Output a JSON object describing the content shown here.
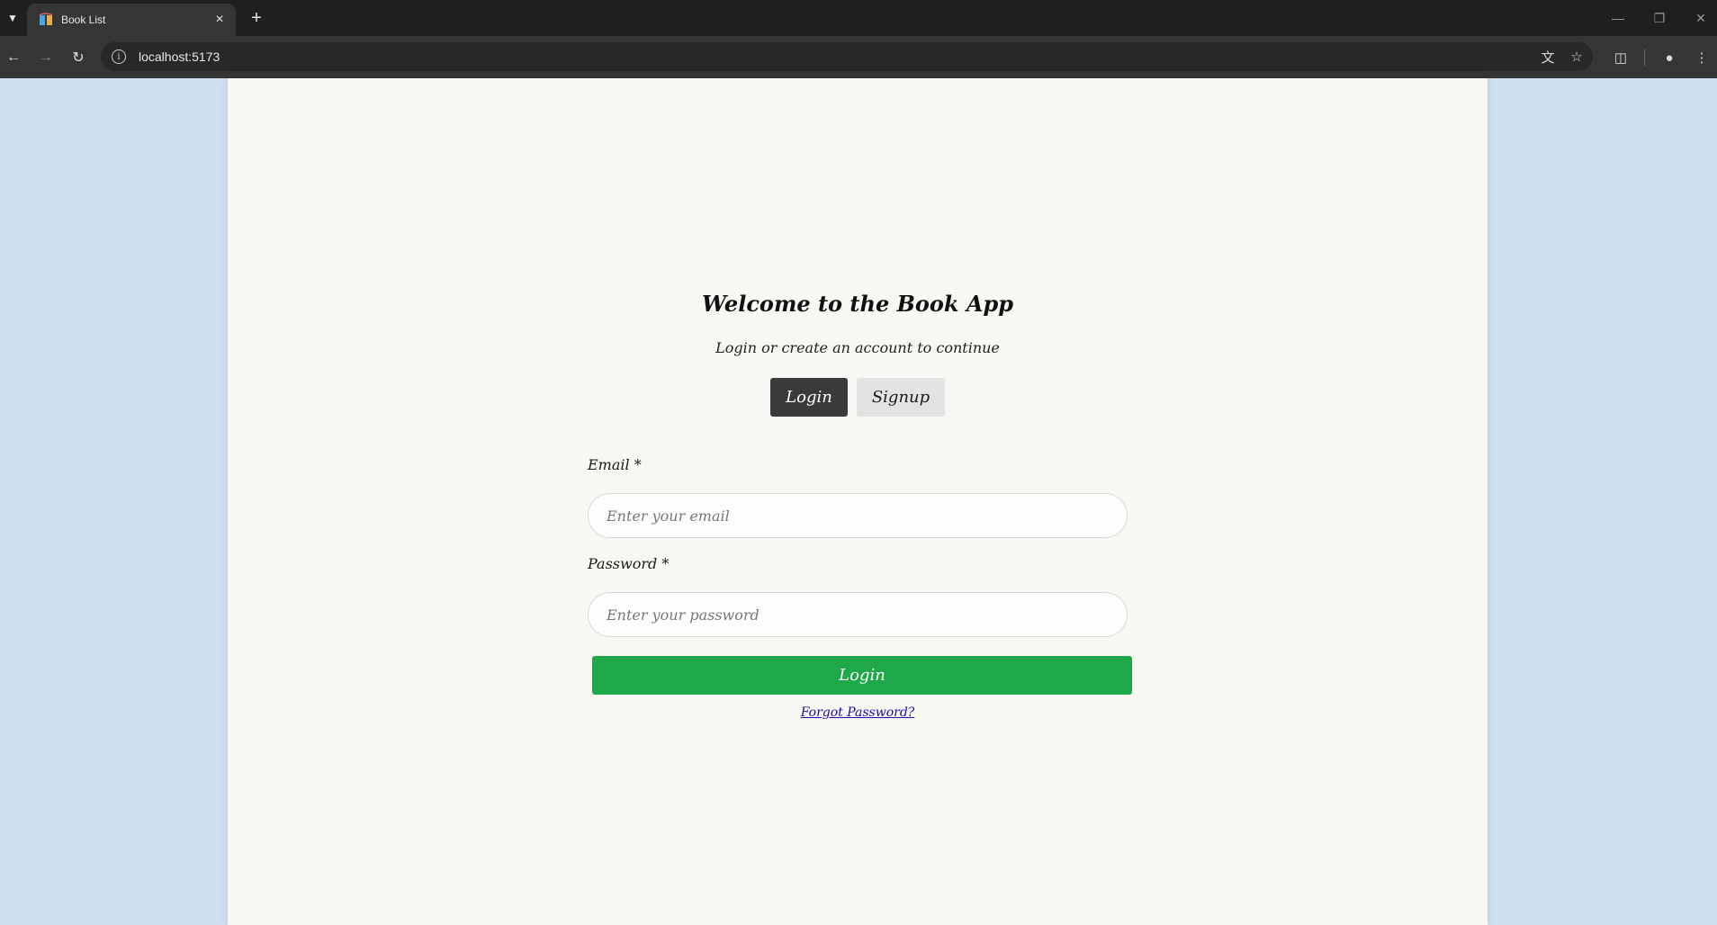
{
  "browser": {
    "tab_title": "Book List",
    "url": "localhost:5173"
  },
  "auth": {
    "welcome_title": "Welcome to the Book App",
    "subtitle": "Login or create an account to continue",
    "mode_login_label": "Login",
    "mode_signup_label": "Signup",
    "active_mode": "Login",
    "email_label": "Email *",
    "email_placeholder": "Enter your email",
    "password_label": "Password *",
    "password_placeholder": "Enter your password",
    "submit_label": "Login",
    "forgot_label": "Forgot Password?"
  },
  "colors": {
    "page_background": "#cfe0f0",
    "card_background": "#f9f7f3",
    "active_mode_button": "#3a3a3a",
    "inactive_mode_button": "#e3e3e3",
    "submit_button": "#1fa84a",
    "link": "#1a0dab"
  },
  "icons": {
    "tab_menu": "chevron-down-icon",
    "favicon": "book-app-favicon",
    "tab_close": "close-icon",
    "new_tab": "plus-icon",
    "back": "arrow-left-icon",
    "forward": "arrow-right-icon",
    "reload": "reload-icon",
    "site_info": "info-icon",
    "translate": "translate-icon",
    "bookmark": "star-icon",
    "extensions": "puzzle-icon",
    "profile": "person-icon",
    "menu": "kebab-menu-icon"
  }
}
